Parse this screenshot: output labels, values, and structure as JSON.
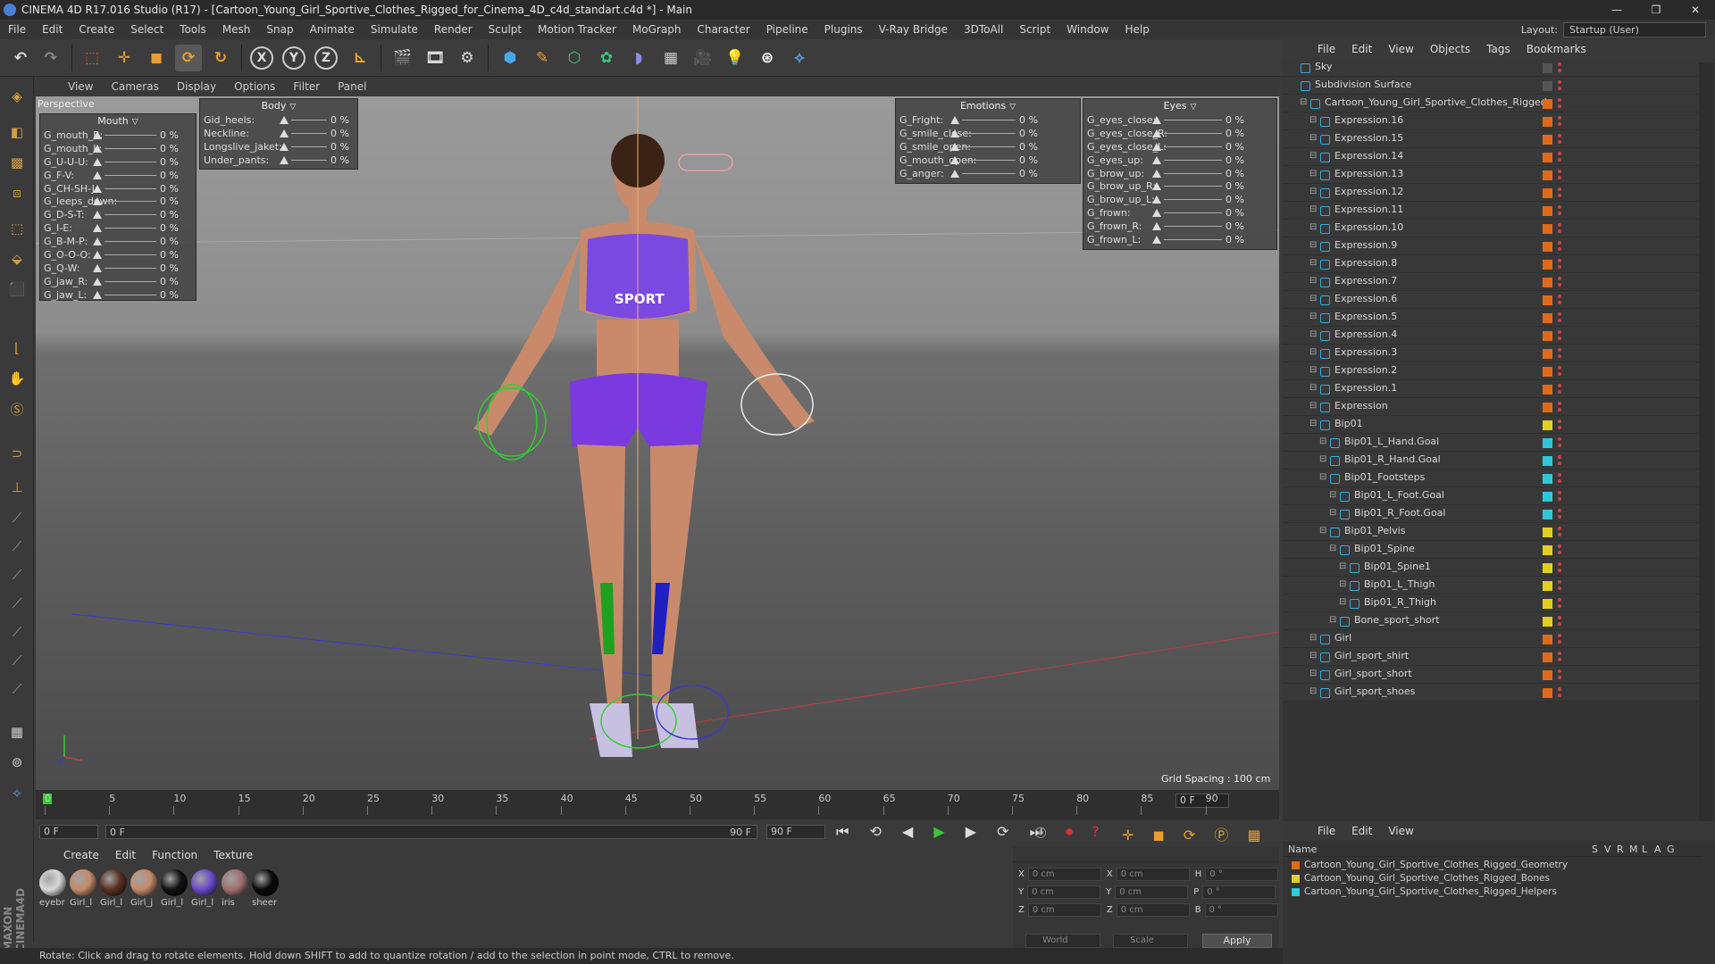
{
  "window": {
    "title": "CINEMA 4D R17.016 Studio (R17) - [Cartoon_Young_Girl_Sportive_Clothes_Rigged_for_Cinema_4D_c4d_standart.c4d *] - Main"
  },
  "menubar": [
    "File",
    "Edit",
    "Create",
    "Select",
    "Tools",
    "Mesh",
    "Snap",
    "Animate",
    "Simulate",
    "Render",
    "Sculpt",
    "Motion Tracker",
    "MoGraph",
    "Character",
    "Pipeline",
    "Plugins",
    "V-Ray Bridge",
    "3DToAll",
    "Script",
    "Window",
    "Help"
  ],
  "layout": {
    "label": "Layout:",
    "value": "Startup (User)"
  },
  "viewport": {
    "menu": [
      "View",
      "Cameras",
      "Display",
      "Options",
      "Filter",
      "Panel"
    ],
    "name": "Perspective",
    "grid_spacing": "Grid Spacing : 100 cm"
  },
  "mouth_panel": {
    "title": "Mouth",
    "rows": [
      {
        "label": "G_mouth_R:",
        "value": "0 %"
      },
      {
        "label": "G_mouth_L:",
        "value": "0 %"
      },
      {
        "label": "G_U-U-U:",
        "value": "0 %"
      },
      {
        "label": "G_F-V:",
        "value": "0 %"
      },
      {
        "label": "G_CH-SH-J:",
        "value": "0 %"
      },
      {
        "label": "G_leeps_down:",
        "value": "0 %"
      },
      {
        "label": "G_D-S-T:",
        "value": "0 %"
      },
      {
        "label": "G_I-E:",
        "value": "0 %"
      },
      {
        "label": "G_B-M-P:",
        "value": "0 %"
      },
      {
        "label": "G_O-O-O:",
        "value": "0 %"
      },
      {
        "label": "G_Q-W:",
        "value": "0 %"
      },
      {
        "label": "G_jaw_R:",
        "value": "0 %"
      },
      {
        "label": "G_jaw_L:",
        "value": "0 %"
      }
    ]
  },
  "body_panel": {
    "title": "Body",
    "rows": [
      {
        "label": "Gid_heels:",
        "value": "0 %"
      },
      {
        "label": "Neckline:",
        "value": "0 %"
      },
      {
        "label": "Longslive_jaket:",
        "value": "0 %"
      },
      {
        "label": "Under_pants:",
        "value": "0 %"
      }
    ]
  },
  "emotions_panel": {
    "title": "Emotions",
    "rows": [
      {
        "label": "G_Fright:",
        "value": "0 %"
      },
      {
        "label": "G_smile_close:",
        "value": "0 %"
      },
      {
        "label": "G_smile_open:",
        "value": "0 %"
      },
      {
        "label": "G_mouth_open:",
        "value": "0 %"
      },
      {
        "label": "G_anger:",
        "value": "0 %"
      }
    ]
  },
  "eyes_panel": {
    "title": "Eyes",
    "rows": [
      {
        "label": "G_eyes_close:",
        "value": "0 %"
      },
      {
        "label": "G_eyes_close_R:",
        "value": "0 %"
      },
      {
        "label": "G_eyes_close_L:",
        "value": "0 %"
      },
      {
        "label": "G_eyes_up:",
        "value": "0 %"
      },
      {
        "label": "G_brow_up:",
        "value": "0 %"
      },
      {
        "label": "G_brow_up_R:",
        "value": "0 %"
      },
      {
        "label": "G_brow_up_L:",
        "value": "0 %"
      },
      {
        "label": "G_frown:",
        "value": "0 %"
      },
      {
        "label": "G_frown_R:",
        "value": "0 %"
      },
      {
        "label": "G_frown_L:",
        "value": "0 %"
      }
    ]
  },
  "object_manager": {
    "menu": [
      "File",
      "Edit",
      "View",
      "Objects",
      "Tags",
      "Bookmarks"
    ],
    "rows": [
      {
        "name": "Sky",
        "indent": 0,
        "color": "#555555"
      },
      {
        "name": "Subdivision Surface",
        "indent": 0,
        "color": "#555555"
      },
      {
        "name": "Cartoon_Young_Girl_Sportive_Clothes_Rigged",
        "indent": 1,
        "color": "#e06a1a"
      },
      {
        "name": "Expression.16",
        "indent": 2,
        "color": "#e06a1a"
      },
      {
        "name": "Expression.15",
        "indent": 2,
        "color": "#e06a1a"
      },
      {
        "name": "Expression.14",
        "indent": 2,
        "color": "#e06a1a"
      },
      {
        "name": "Expression.13",
        "indent": 2,
        "color": "#e06a1a"
      },
      {
        "name": "Expression.12",
        "indent": 2,
        "color": "#e06a1a"
      },
      {
        "name": "Expression.11",
        "indent": 2,
        "color": "#e06a1a"
      },
      {
        "name": "Expression.10",
        "indent": 2,
        "color": "#e06a1a"
      },
      {
        "name": "Expression.9",
        "indent": 2,
        "color": "#e06a1a"
      },
      {
        "name": "Expression.8",
        "indent": 2,
        "color": "#e06a1a"
      },
      {
        "name": "Expression.7",
        "indent": 2,
        "color": "#e06a1a"
      },
      {
        "name": "Expression.6",
        "indent": 2,
        "color": "#e06a1a"
      },
      {
        "name": "Expression.5",
        "indent": 2,
        "color": "#e06a1a"
      },
      {
        "name": "Expression.4",
        "indent": 2,
        "color": "#e06a1a"
      },
      {
        "name": "Expression.3",
        "indent": 2,
        "color": "#e06a1a"
      },
      {
        "name": "Expression.2",
        "indent": 2,
        "color": "#e06a1a"
      },
      {
        "name": "Expression.1",
        "indent": 2,
        "color": "#e06a1a"
      },
      {
        "name": "Expression",
        "indent": 2,
        "color": "#e06a1a"
      },
      {
        "name": "Bip01",
        "indent": 2,
        "color": "#e0d020"
      },
      {
        "name": "Bip01_L_Hand.Goal",
        "indent": 3,
        "color": "#30c8d8"
      },
      {
        "name": "Bip01_R_Hand.Goal",
        "indent": 3,
        "color": "#30c8d8"
      },
      {
        "name": "Bip01_Footsteps",
        "indent": 3,
        "color": "#30c8d8"
      },
      {
        "name": "Bip01_L_Foot.Goal",
        "indent": 4,
        "color": "#30c8d8"
      },
      {
        "name": "Bip01_R_Foot.Goal",
        "indent": 4,
        "color": "#30c8d8"
      },
      {
        "name": "Bip01_Pelvis",
        "indent": 3,
        "color": "#e0d020"
      },
      {
        "name": "Bip01_Spine",
        "indent": 4,
        "color": "#e0d020"
      },
      {
        "name": "Bip01_Spine1",
        "indent": 5,
        "color": "#e0d020"
      },
      {
        "name": "Bip01_L_Thigh",
        "indent": 5,
        "color": "#e0d020"
      },
      {
        "name": "Bip01_R_Thigh",
        "indent": 5,
        "color": "#e0d020"
      },
      {
        "name": "Bone_sport_short",
        "indent": 4,
        "color": "#e0d020"
      },
      {
        "name": "Girl",
        "indent": 2,
        "color": "#e06a1a"
      },
      {
        "name": "Girl_sport_shirt",
        "indent": 2,
        "color": "#e06a1a"
      },
      {
        "name": "Girl_sport_short",
        "indent": 2,
        "color": "#e06a1a"
      },
      {
        "name": "Girl_sport_shoes",
        "indent": 2,
        "color": "#e06a1a"
      }
    ]
  },
  "layer_manager": {
    "menu": [
      "File",
      "Edit",
      "View"
    ],
    "header": "Name",
    "cols": [
      "S",
      "V",
      "R",
      "M",
      "L",
      "A",
      "G"
    ],
    "rows": [
      {
        "name": "Cartoon_Young_Girl_Sportive_Clothes_Rigged_Geometry",
        "color": "#e06a1a"
      },
      {
        "name": "Cartoon_Young_Girl_Sportive_Clothes_Rigged_Bones",
        "color": "#e0d020"
      },
      {
        "name": "Cartoon_Young_Girl_Sportive_Clothes_Rigged_Helpers",
        "color": "#30c8d8"
      }
    ]
  },
  "timeline": {
    "ticks": [
      "0",
      "5",
      "10",
      "15",
      "20",
      "25",
      "30",
      "35",
      "40",
      "45",
      "50",
      "55",
      "60",
      "65",
      "70",
      "75",
      "80",
      "85",
      "90"
    ],
    "frame_field": "0 F",
    "start": "0 F",
    "range_start": "0 F",
    "range_end": "90 F",
    "end": "90 F"
  },
  "materials": {
    "menu": [
      "Create",
      "Edit",
      "Function",
      "Texture"
    ],
    "items": [
      {
        "label": "eyebr",
        "color": "#d8d8d8"
      },
      {
        "label": "Girl_l",
        "color": "#c48a6a"
      },
      {
        "label": "Girl_l",
        "color": "#5a3020"
      },
      {
        "label": "Girl_j",
        "color": "#c48a6a"
      },
      {
        "label": "Girl_l",
        "color": "#111111"
      },
      {
        "label": "Girl_l",
        "color": "#6a4ac8"
      },
      {
        "label": "iris",
        "color": "#a07070"
      },
      {
        "label": "sheer",
        "color": "#0a0a0a"
      }
    ]
  },
  "coordinates": {
    "rows": [
      {
        "a": "X",
        "av": "0 cm",
        "b": "X",
        "bv": "0 cm",
        "c": "H",
        "cv": "0 °"
      },
      {
        "a": "Y",
        "av": "0 cm",
        "b": "Y",
        "bv": "0 cm",
        "c": "P",
        "cv": "0 °"
      },
      {
        "a": "Z",
        "av": "0 cm",
        "b": "Z",
        "bv": "0 cm",
        "c": "B",
        "cv": "0 °"
      }
    ],
    "world": "World",
    "scale": "Scale",
    "apply": "Apply"
  },
  "status": "Rotate: Click and drag to rotate elements. Hold down SHIFT to add to quantize rotation / add to the selection in point mode, CTRL to remove."
}
